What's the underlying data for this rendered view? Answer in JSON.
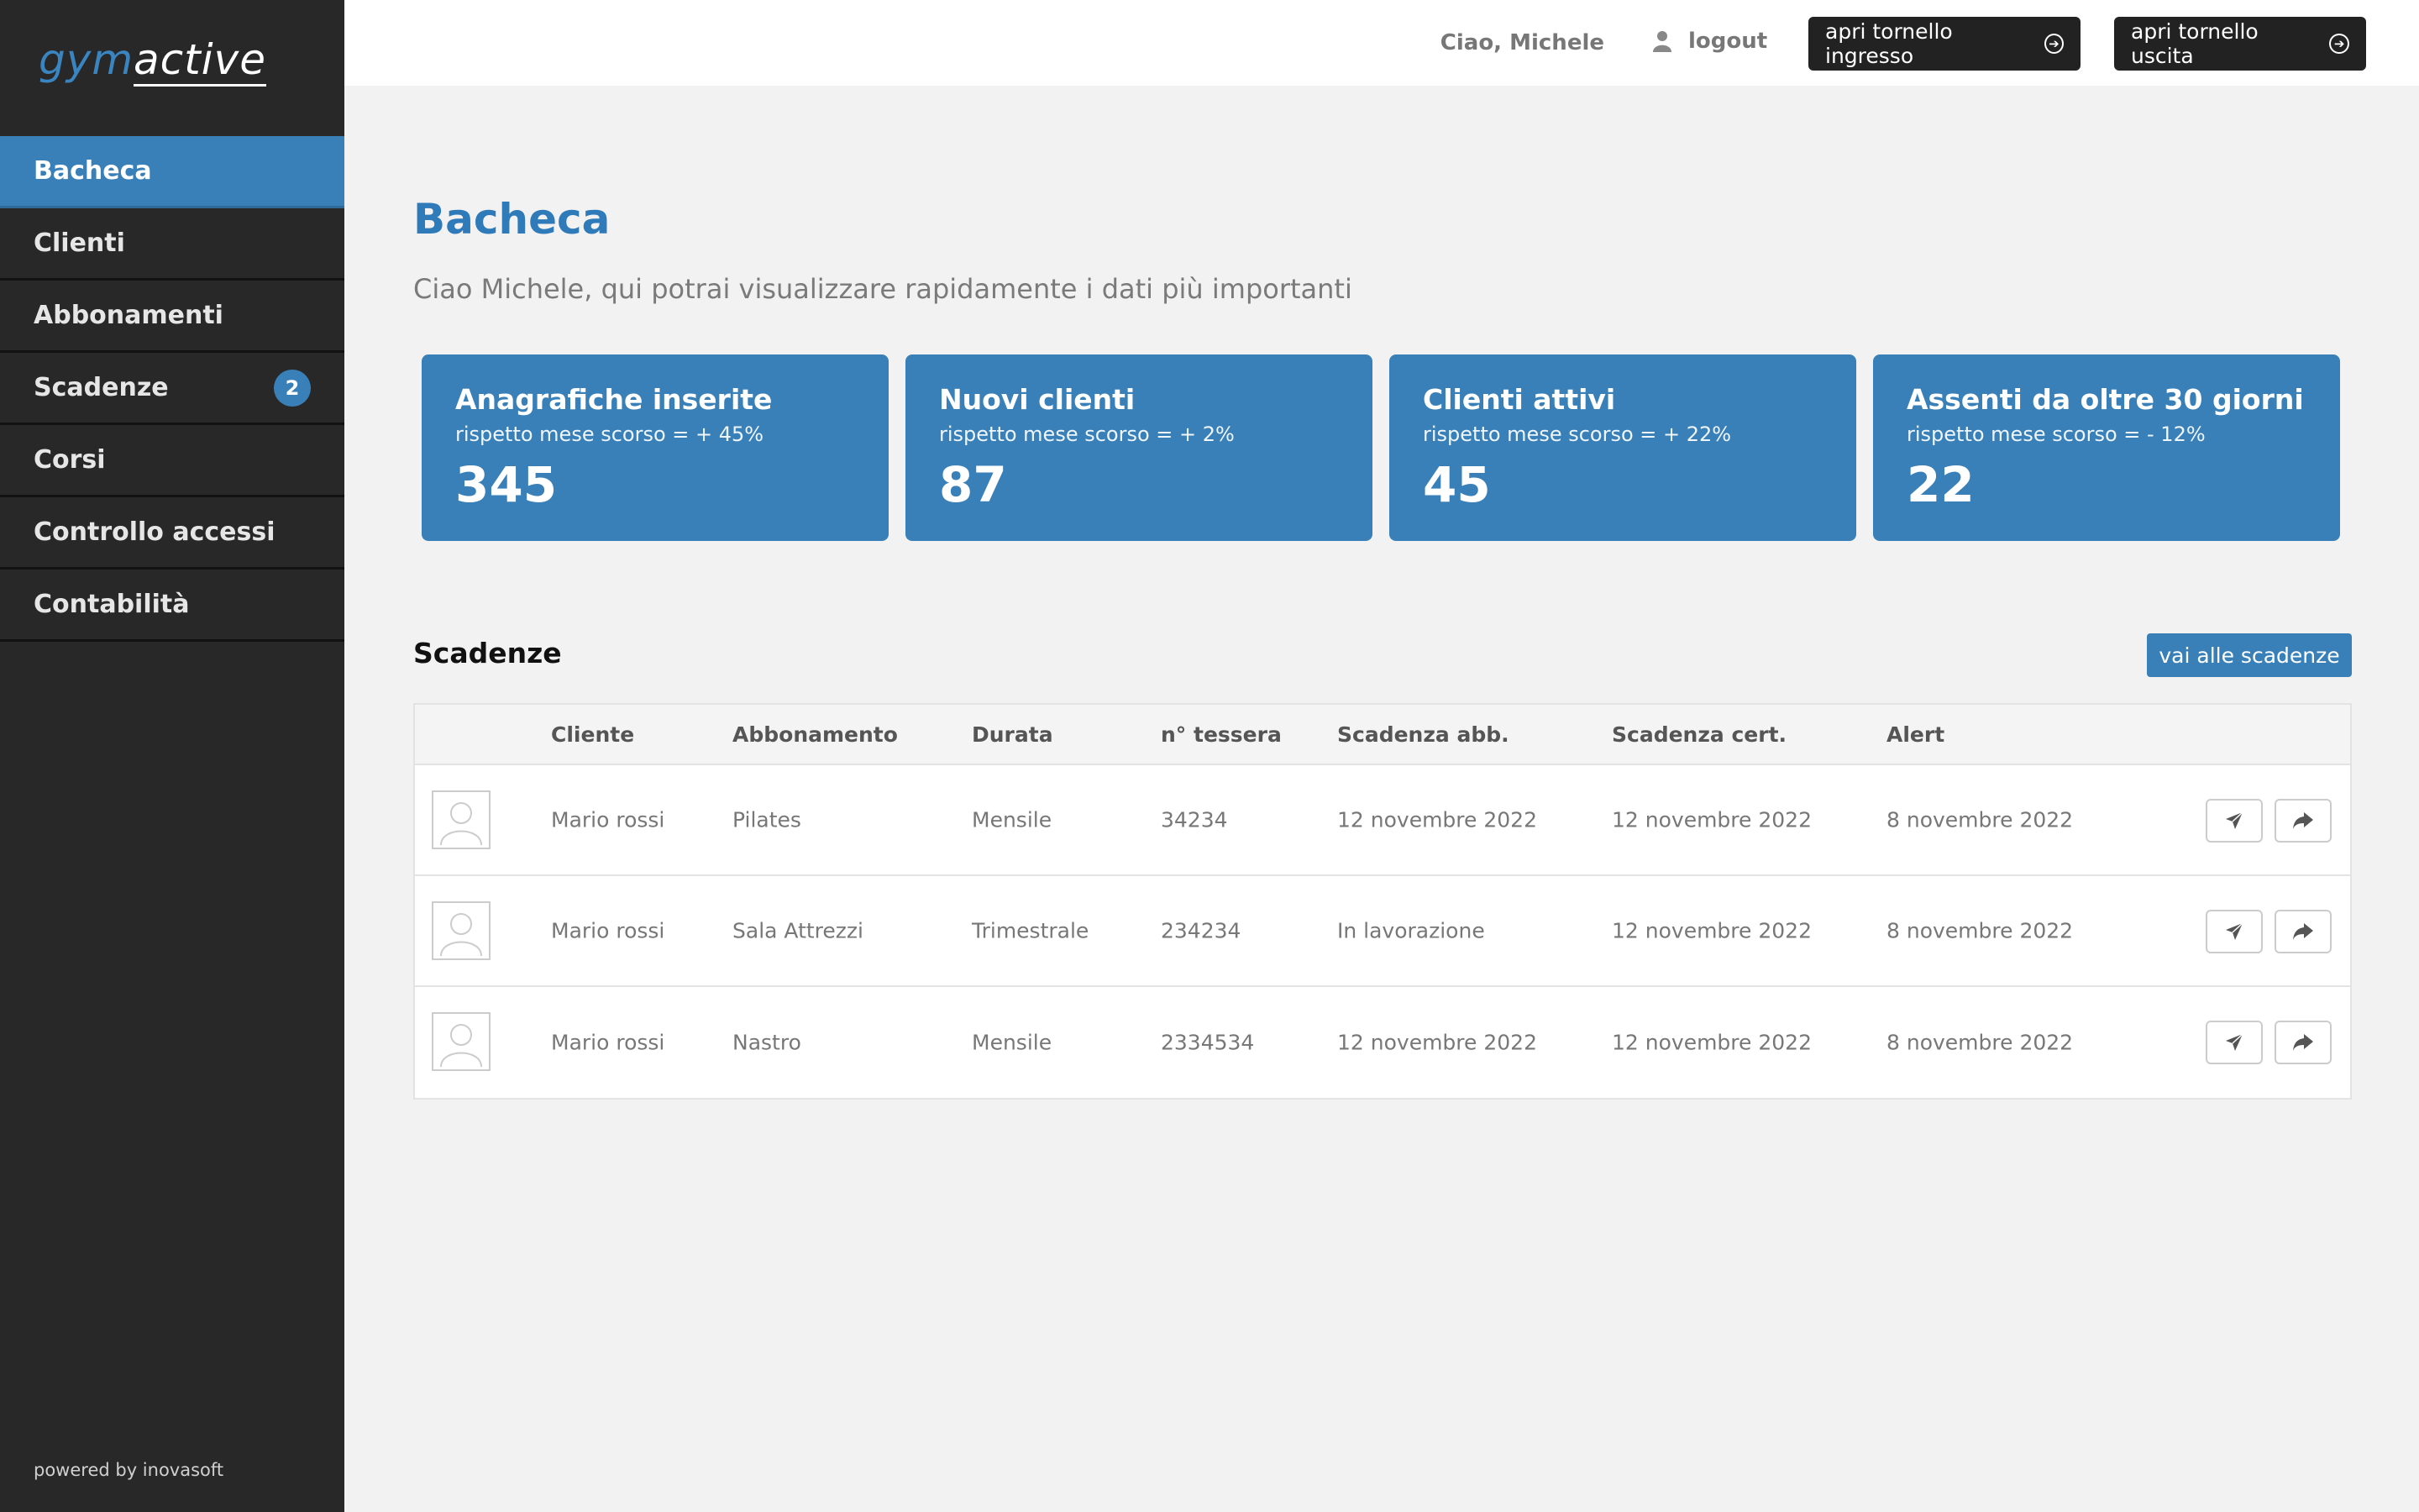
{
  "brand": {
    "part1": "gym",
    "part2": "active"
  },
  "sidebar": {
    "items": [
      {
        "label": "Bacheca"
      },
      {
        "label": "Clienti"
      },
      {
        "label": "Abbonamenti"
      },
      {
        "label": "Scadenze",
        "badge": "2"
      },
      {
        "label": "Corsi"
      },
      {
        "label": "Controllo accessi"
      },
      {
        "label": "Contabilità"
      }
    ],
    "footer": "powered by inovasoft"
  },
  "header": {
    "greeting": "Ciao, Michele",
    "logout": "logout",
    "btn_in": "apri tornello ingresso",
    "btn_out": "apri tornello uscita"
  },
  "page": {
    "title": "Bacheca",
    "subtitle": "Ciao Michele, qui potrai visualizzare rapidamente i dati più importanti"
  },
  "cards": [
    {
      "title": "Anagrafiche inserite",
      "sub": "rispetto mese scorso = + 45%",
      "value": "345"
    },
    {
      "title": "Nuovi clienti",
      "sub": "rispetto mese scorso = + 2%",
      "value": "87"
    },
    {
      "title": "Clienti attivi",
      "sub": "rispetto mese scorso = + 22%",
      "value": "45"
    },
    {
      "title": "Assenti da oltre 30 giorni",
      "sub": "rispetto mese scorso = - 12%",
      "value": "22"
    }
  ],
  "scadenze": {
    "title": "Scadenze",
    "button": "vai alle scadenze",
    "headers": [
      "Cliente",
      "Abbonamento",
      "Durata",
      "n° tessera",
      "Scadenza abb.",
      "Scadenza cert.",
      "Alert"
    ],
    "rows": [
      [
        "Mario rossi",
        "Pilates",
        "Mensile",
        "34234",
        "12 novembre 2022",
        "12 novembre 2022",
        "8 novembre 2022"
      ],
      [
        "Mario rossi",
        "Sala Attrezzi",
        "Trimestrale",
        "234234",
        "In lavorazione",
        "12 novembre 2022",
        "8 novembre 2022"
      ],
      [
        "Mario rossi",
        "Nastro",
        "Mensile",
        "2334534",
        "12 novembre 2022",
        "12 novembre 2022",
        "8 novembre 2022"
      ]
    ]
  },
  "colors": {
    "accent": "#3a80b8",
    "sidebar": "#282828"
  }
}
